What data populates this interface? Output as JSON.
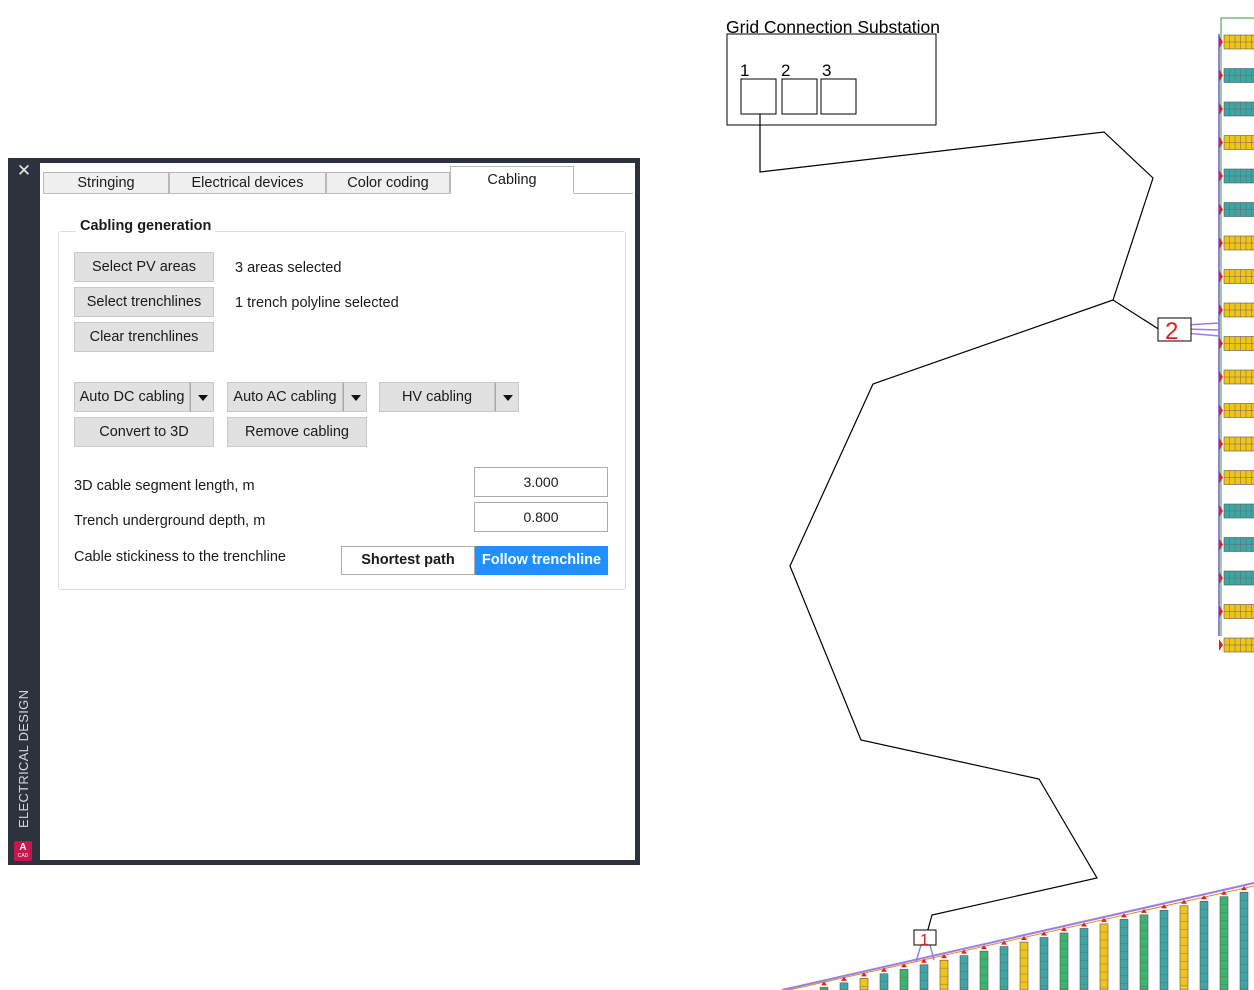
{
  "palette": {
    "title": "ELECTRICAL DESIGN",
    "logo_text": "A",
    "logo_sub": "CAD",
    "tabs": [
      {
        "label": "Stringing"
      },
      {
        "label": "Electrical devices"
      },
      {
        "label": "Color coding"
      },
      {
        "label": "Cabling",
        "active": true
      }
    ]
  },
  "cabling": {
    "group_title": "Cabling generation",
    "select_pv_label": "Select PV areas",
    "select_pv_status": "3 areas selected",
    "select_trench_label": "Select trenchlines",
    "select_trench_status": "1 trench polyline selected",
    "clear_trench_label": "Clear trenchlines",
    "auto_dc_label": "Auto DC cabling",
    "auto_ac_label": "Auto AC cabling",
    "hv_label": "HV cabling",
    "convert_3d_label": "Convert to 3D",
    "remove_label": "Remove cabling",
    "segment_length_label": "3D cable segment length, m",
    "segment_length_value": "3.000",
    "trench_depth_label": "Trench underground depth, m",
    "trench_depth_value": "0.800",
    "stickiness_label": "Cable stickiness to the trenchline",
    "stickiness_options": [
      "Shortest path",
      "Follow trenchline"
    ],
    "stickiness_selected": "Follow trenchline"
  },
  "drawing": {
    "substation_title": "Grid Connection Substation",
    "bay_labels": [
      "1",
      "2",
      "3"
    ],
    "inverter_top_label": "2",
    "inverter_bottom_label": "1",
    "colors": {
      "accent": "#1e90ff",
      "label_red": "#e0201b",
      "cable_purple": "#9b7fe0",
      "module_yellow": "#f0c419",
      "module_teal": "#3fa6a6",
      "module_green": "#3cb371",
      "boundary_green": "#3a9a3a"
    }
  }
}
